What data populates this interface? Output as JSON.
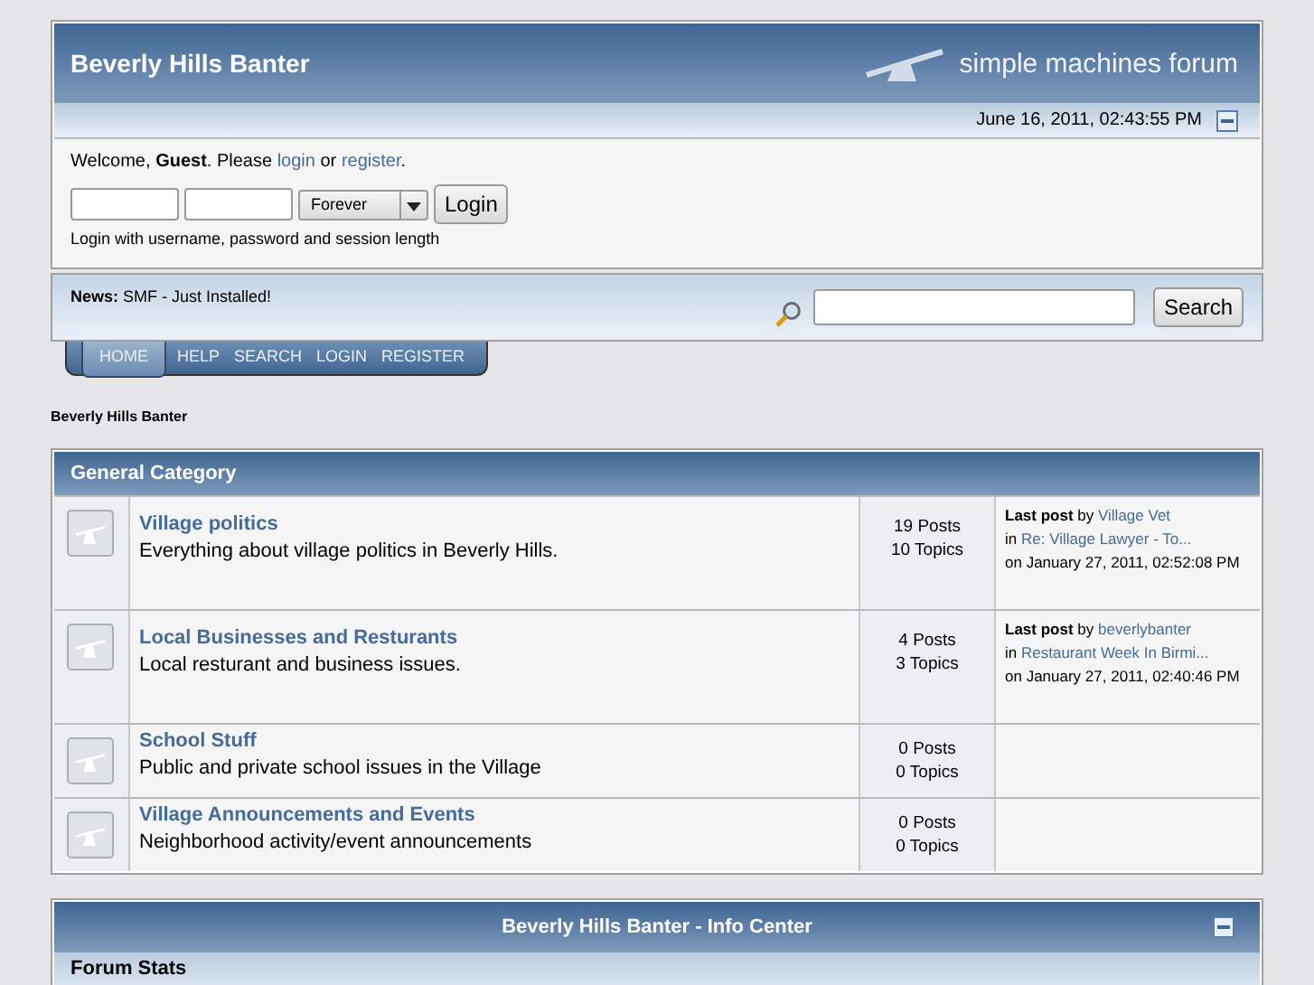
{
  "header": {
    "title": "Beverly Hills Banter",
    "logo_text": "simple machines forum"
  },
  "date_bar": {
    "time": "June 16, 2011, 02:43:55 PM"
  },
  "user": {
    "welcome": "Welcome, **Guest**. Please",
    "login_link": "login",
    "or": "or",
    "register_link": "register",
    "end": ".",
    "session_option": "Forever",
    "login_button": "Login",
    "hint": "Login with username, password and session length"
  },
  "news": {
    "label": "News:",
    "text": "SMF - Just Installed!",
    "search_button": "Search"
  },
  "menu": [
    {
      "label": "HOME",
      "selected": true
    },
    {
      "label": "HELP",
      "selected": false
    },
    {
      "label": "SEARCH",
      "selected": false
    },
    {
      "label": "LOGIN",
      "selected": false
    },
    {
      "label": "REGISTER",
      "selected": false
    }
  ],
  "linktree": "Beverly Hills Banter",
  "category": {
    "title": "General Category",
    "boards": [
      {
        "name": "Village politics",
        "description": "Everything about village politics in Beverly Hills.",
        "posts": "19 Posts",
        "topics": "10 Topics",
        "last_post": {
          "label": "Last post",
          "by": "by",
          "author": "Village Vet",
          "in": "in",
          "topic": "Re: Village Lawyer - To...",
          "on": "on January 27, 2011, 02:52:08 PM"
        }
      },
      {
        "name": "Local Businesses and Resturants",
        "description": "Local resturant and business issues.",
        "posts": "4 Posts",
        "topics": "3 Topics",
        "last_post": {
          "label": "Last post",
          "by": "by",
          "author": "beverlybanter",
          "in": "in",
          "topic": "Restaurant Week In Birmi...",
          "on": "on January 27, 2011, 02:40:46 PM"
        }
      },
      {
        "name": "School Stuff",
        "description": "Public and private school issues in the Village",
        "posts": "0 Posts",
        "topics": "0 Topics"
      },
      {
        "name": "Village Announcements and Events",
        "description": "Neighborhood activity/event announcements",
        "posts": "0 Posts",
        "topics": "0 Topics"
      }
    ]
  },
  "info_center": {
    "title": "Beverly Hills Banter - Info Center",
    "section": "Forum Stats"
  }
}
